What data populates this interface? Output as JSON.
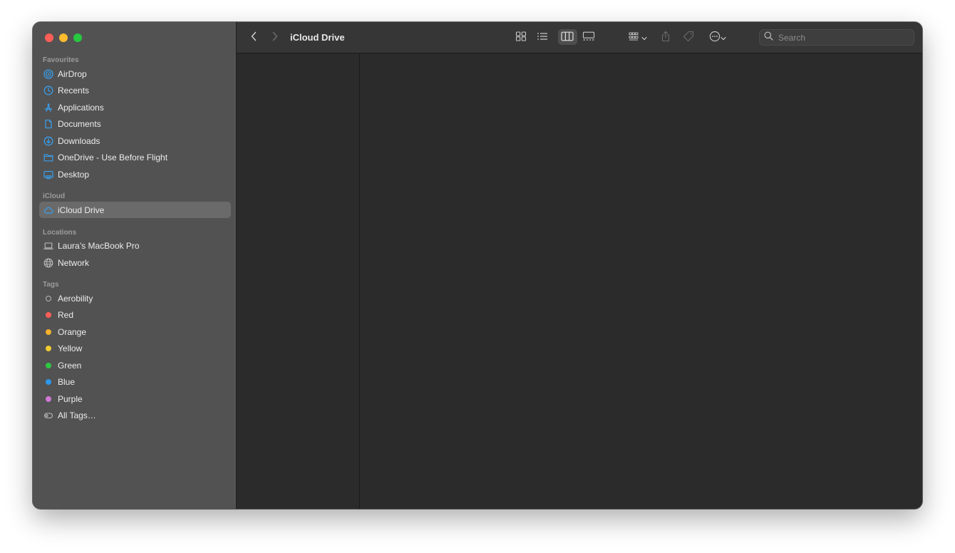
{
  "toolbar": {
    "title": "iCloud Drive",
    "search_placeholder": "Search"
  },
  "sidebar": {
    "favourites_header": "Favourites",
    "favourites": [
      {
        "label": "AirDrop",
        "icon": "airdrop-icon"
      },
      {
        "label": "Recents",
        "icon": "clock-icon"
      },
      {
        "label": "Applications",
        "icon": "applications-icon"
      },
      {
        "label": "Documents",
        "icon": "document-icon"
      },
      {
        "label": "Downloads",
        "icon": "download-icon"
      },
      {
        "label": "OneDrive - Use Before Flight",
        "icon": "folder-icon"
      },
      {
        "label": "Desktop",
        "icon": "desktop-icon"
      }
    ],
    "icloud_header": "iCloud",
    "icloud": [
      {
        "label": "iCloud Drive",
        "icon": "cloud-icon",
        "selected": true
      }
    ],
    "locations_header": "Locations",
    "locations": [
      {
        "label": "Laura’s MacBook Pro",
        "icon": "laptop-icon"
      },
      {
        "label": "Network",
        "icon": "globe-icon"
      }
    ],
    "tags_header": "Tags",
    "tags": [
      {
        "label": "Aerobility",
        "color": "#b8b8b8",
        "hollow": true
      },
      {
        "label": "Red",
        "color": "#ff5f57"
      },
      {
        "label": "Orange",
        "color": "#f7b12d"
      },
      {
        "label": "Yellow",
        "color": "#f2cc2f"
      },
      {
        "label": "Green",
        "color": "#2fc644"
      },
      {
        "label": "Blue",
        "color": "#2c97ec"
      },
      {
        "label": "Purple",
        "color": "#cf78d6"
      },
      {
        "label": "All Tags…",
        "icon": "all-tags-icon"
      }
    ]
  },
  "colors": {
    "accent": "#3a9eea",
    "sidebar_bg": "#525252",
    "content_bg": "#2b2b2b"
  }
}
